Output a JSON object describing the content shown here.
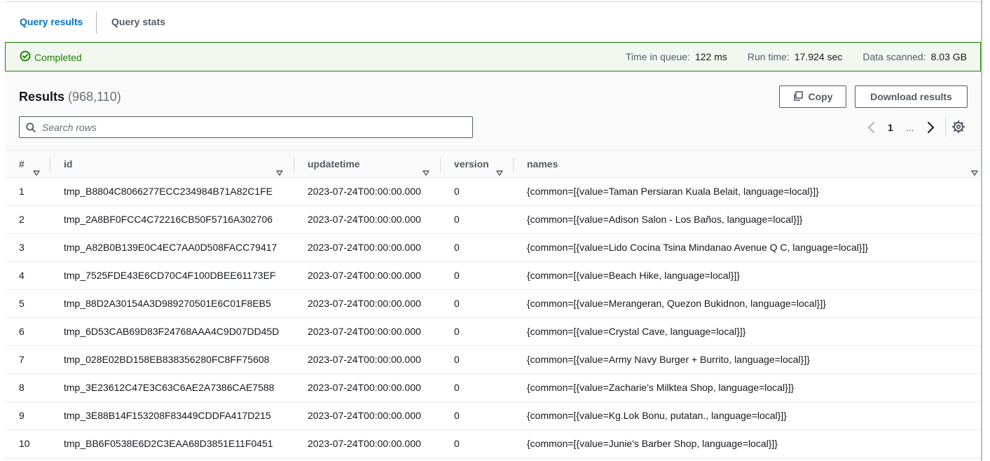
{
  "tabs": [
    {
      "label": "Query results",
      "active": true
    },
    {
      "label": "Query stats",
      "active": false
    }
  ],
  "status": {
    "label": "Completed",
    "color": "#1d8102",
    "time_in_queue_label": "Time in queue:",
    "time_in_queue": "122 ms",
    "run_time_label": "Run time:",
    "run_time": "17.924 sec",
    "data_scanned_label": "Data scanned:",
    "data_scanned": "8.03 GB"
  },
  "results": {
    "title": "Results",
    "count": "(968,110)",
    "copy_label": "Copy",
    "download_label": "Download results",
    "search_placeholder": "Search rows",
    "page": "1",
    "ellipsis": "..."
  },
  "table": {
    "columns": [
      "#",
      "id",
      "updatetime",
      "version",
      "names"
    ],
    "rows": [
      [
        "1",
        "tmp_B8804C8066277ECC234984B71A82C1FE",
        "2023-07-24T00:00:00.000",
        "0",
        "{common=[{value=Taman Persiaran Kuala Belait, language=local}]}"
      ],
      [
        "2",
        "tmp_2A8BF0FCC4C72216CB50F5716A302706",
        "2023-07-24T00:00:00.000",
        "0",
        "{common=[{value=Adison Salon - Los Baños, language=local}]}"
      ],
      [
        "3",
        "tmp_A82B0B139E0C4EC7AA0D508FACC79417",
        "2023-07-24T00:00:00.000",
        "0",
        "{common=[{value=Lido Cocina Tsina Mindanao Avenue Q C, language=local}]}"
      ],
      [
        "4",
        "tmp_7525FDE43E6CD70C4F100DBEE61173EF",
        "2023-07-24T00:00:00.000",
        "0",
        "{common=[{value=Beach Hike, language=local}]}"
      ],
      [
        "5",
        "tmp_88D2A30154A3D989270501E6C01F8EB5",
        "2023-07-24T00:00:00.000",
        "0",
        "{common=[{value=Merangeran, Quezon Bukidnon, language=local}]}"
      ],
      [
        "6",
        "tmp_6D53CAB69D83F24768AAA4C9D07DD45D",
        "2023-07-24T00:00:00.000",
        "0",
        "{common=[{value=Crystal Cave, language=local}]}"
      ],
      [
        "7",
        "tmp_028E02BD158EB838356280FC8FF75608",
        "2023-07-24T00:00:00.000",
        "0",
        "{common=[{value=Army Navy Burger + Burrito, language=local}]}"
      ],
      [
        "8",
        "tmp_3E23612C47E3C63C6AE2A7386CAE7588",
        "2023-07-24T00:00:00.000",
        "0",
        "{common=[{value=Zacharie's Milktea Shop, language=local}]}"
      ],
      [
        "9",
        "tmp_3E88B14F153208F83449CDDFA417D215",
        "2023-07-24T00:00:00.000",
        "0",
        "{common=[{value=Kg.Lok Bonu, putatan., language=local}]}"
      ],
      [
        "10",
        "tmp_BB6F0538E6D2C3EAA68D3851E11F0451",
        "2023-07-24T00:00:00.000",
        "0",
        "{common=[{value=Junie's Barber Shop, language=local}]}"
      ]
    ]
  },
  "icons": [
    "check-circle-icon",
    "copy-icon",
    "search-icon",
    "chevron-left-icon",
    "chevron-right-icon",
    "gear-icon",
    "sort-caret-icon"
  ],
  "colors": {
    "accent": "#0073bb",
    "success": "#1d8102",
    "border": "#545b64"
  }
}
